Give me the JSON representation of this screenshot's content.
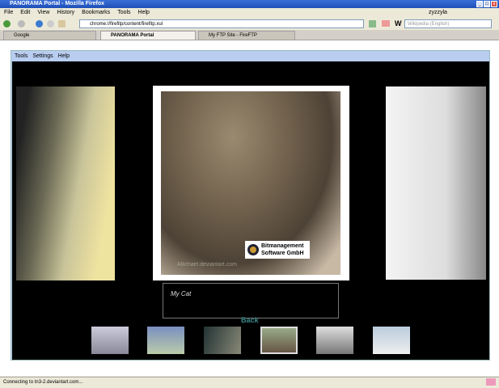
{
  "window": {
    "title": "PANORAMA Portal - Mozilla Firefox"
  },
  "menu": [
    "File",
    "Edit",
    "View",
    "History",
    "Bookmarks",
    "Tools",
    "Help"
  ],
  "toolbar": {
    "url": "chrome://firefitp/content/firefitp.xul",
    "search_placeholder": "Wikipedia (English)",
    "user": "zyzzyla"
  },
  "tabs": [
    {
      "label": "Google"
    },
    {
      "label": "PANORAMA Portal",
      "active": true
    },
    {
      "label": "My FTP Site - FireFTP"
    }
  ],
  "app": {
    "menu": [
      "Tools",
      "Settings",
      "Help"
    ],
    "caption": "My Cat",
    "back_label": "Back",
    "logo_text": "Bitmanagement Software GmbH",
    "watermark": "Allichael.deviantart.com"
  },
  "status": {
    "text": "Connecting to tn3-2.deviantart.com..."
  }
}
